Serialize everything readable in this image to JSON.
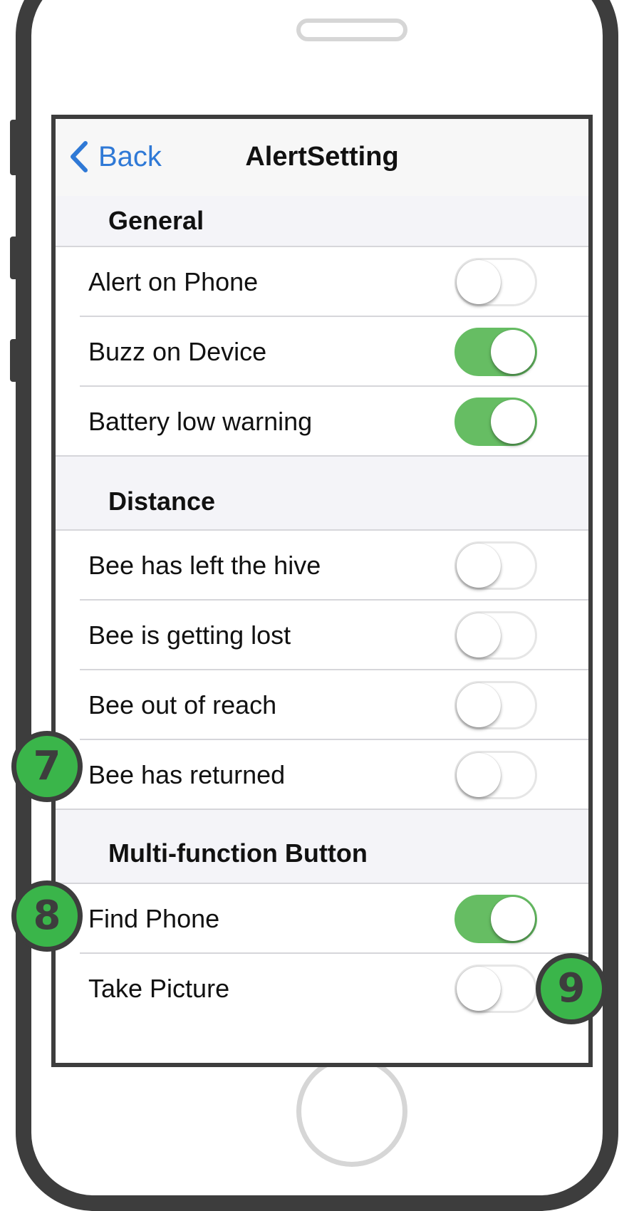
{
  "colors": {
    "accent": "#2f79d6",
    "toggle_on": "#66bd63",
    "badge": "#3ab54a",
    "frame": "#3d3d3d"
  },
  "navbar": {
    "back_icon": "chevron-left-icon",
    "back_label": "Back",
    "title": "AlertSetting"
  },
  "sections": [
    {
      "header": "General",
      "rows": [
        {
          "label": "Alert on Phone",
          "on": false
        },
        {
          "label": "Buzz on Device",
          "on": true
        },
        {
          "label": "Battery low warning",
          "on": true
        }
      ]
    },
    {
      "header": "Distance",
      "rows": [
        {
          "label": "Bee has left the hive",
          "on": false
        },
        {
          "label": "Bee is getting lost",
          "on": false
        },
        {
          "label": "Bee out of reach",
          "on": false
        },
        {
          "label": "Bee has returned",
          "on": false
        }
      ]
    },
    {
      "header": "Multi-function Button",
      "rows": [
        {
          "label": "Find Phone",
          "on": true
        },
        {
          "label": "Take Picture",
          "on": false
        }
      ]
    }
  ],
  "badges": [
    "7",
    "8",
    "9"
  ]
}
